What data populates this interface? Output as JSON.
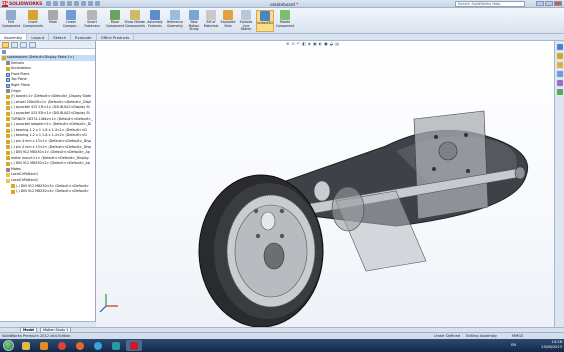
{
  "app": {
    "logo_text": "SOLIDWORKS",
    "document_title": "sakateboard *",
    "search_placeholder": "Search SolidWorks Help"
  },
  "ribbon": {
    "buttons": [
      {
        "label": "Edit Component"
      },
      {
        "label": "Insert Components"
      },
      {
        "label": "Mate"
      },
      {
        "label": "Linear Compon..."
      },
      {
        "label": "Smart Fasteners"
      },
      {
        "label": "Move Component"
      },
      {
        "label": "Show Hidden Components"
      },
      {
        "label": "Assembly Features"
      },
      {
        "label": "Reference Geometry"
      },
      {
        "label": "New Motion Study"
      },
      {
        "label": "Bill of Materials"
      },
      {
        "label": "Exploded View"
      },
      {
        "label": "Explode Line Sketch"
      },
      {
        "label": "Instant3D"
      },
      {
        "label": "Rotate Component"
      }
    ],
    "active": "Instant3D"
  },
  "command_tabs": [
    "Assembly",
    "Layout",
    "Sketch",
    "Evaluate",
    "Office Products"
  ],
  "active_command_tab": "Assembly",
  "feature_tree": [
    {
      "label": "sakateboard  (Default<Display State-1>)",
      "icon": "assembly-icon",
      "indent": 0
    },
    {
      "label": "Sensors",
      "icon": "sensor-icon",
      "indent": 1
    },
    {
      "label": "Annotations",
      "icon": "annotation-icon",
      "indent": 1
    },
    {
      "label": "Front Plane",
      "icon": "plane-icon",
      "indent": 1
    },
    {
      "label": "Top Plane",
      "icon": "plane-icon",
      "indent": 1
    },
    {
      "label": "Right Plane",
      "icon": "plane-icon",
      "indent": 1
    },
    {
      "label": "Origin",
      "icon": "origin-icon",
      "indent": 1
    },
    {
      "label": "(f) board<1> (Default<<Default>_Display State",
      "icon": "part-icon",
      "indent": 1
    },
    {
      "label": "(-) wheel 200x50<1> (Default<<Default>_Displ",
      "icon": "part-icon",
      "indent": 1
    },
    {
      "label": "(-) sprocket 415 13t<1> (DSUB-002<Display St",
      "icon": "part-icon",
      "indent": 1
    },
    {
      "label": "(-) sprocket 415 55t<1> (DSUB-002<Display St",
      "icon": "part-icon",
      "indent": 1
    },
    {
      "label": "TURNIGY C6374-148kv<1> (Default<<Default>_",
      "icon": "part-icon",
      "indent": 1
    },
    {
      "label": "(-) sprocket adapter<1> (Default<<Default>_Di",
      "icon": "part-icon",
      "indent": 1
    },
    {
      "label": "(-) bearing 1-2 x 1 1-8 x 1-4<1> (Default<<D",
      "icon": "part-icon",
      "indent": 1
    },
    {
      "label": "(-) bearing 1-2 x 1 1-8 x 1-4<2> (Default<<D",
      "icon": "part-icon",
      "indent": 1
    },
    {
      "label": "(-) pin 4 mm x 13<1> (Default<<Default>_Disp",
      "icon": "part-icon",
      "indent": 1
    },
    {
      "label": "(-) pin 4 mm x 13<2> (Default<<Default>_Disp",
      "icon": "part-icon",
      "indent": 1
    },
    {
      "label": "(-) DIN 912 M8X30<1> (Default<<Default>_Ap",
      "icon": "part-icon",
      "indent": 1
    },
    {
      "label": "motor mount<1> (Default<<Default>_Display",
      "icon": "part-icon",
      "indent": 1
    },
    {
      "label": "(-) DIN 912 M8X30<2> (Default<<Default>_Ap",
      "icon": "part-icon",
      "indent": 1
    },
    {
      "label": "Mates",
      "icon": "mates-icon",
      "indent": 1
    },
    {
      "label": "LocalCirPattern1",
      "icon": "pattern-icon",
      "indent": 1
    },
    {
      "label": "LocalCirPattern2",
      "icon": "pattern-icon",
      "indent": 1
    },
    {
      "label": "(-) DIN 912 M8X30<3> (Default<<Default>",
      "icon": "part-icon",
      "indent": 2
    },
    {
      "label": "(-) DIN 912 M8X30<4> (Default<<Default>",
      "icon": "part-icon",
      "indent": 2
    }
  ],
  "bottom_tabs": [
    "Model",
    "Motion Study 1"
  ],
  "active_bottom_tab": "Model",
  "status": {
    "left": "SolidWorks Premium 2012 x64 Edition",
    "state": "Under Defined",
    "mode": "Editing Assembly",
    "units": "MMGS"
  },
  "taskbar": {
    "lang": "EN",
    "time": "14:26",
    "date": "25/06/2013"
  },
  "colors": {
    "accent": "#f8dd8a",
    "brand": "#c0202a",
    "taskbar": "#1c355a"
  }
}
